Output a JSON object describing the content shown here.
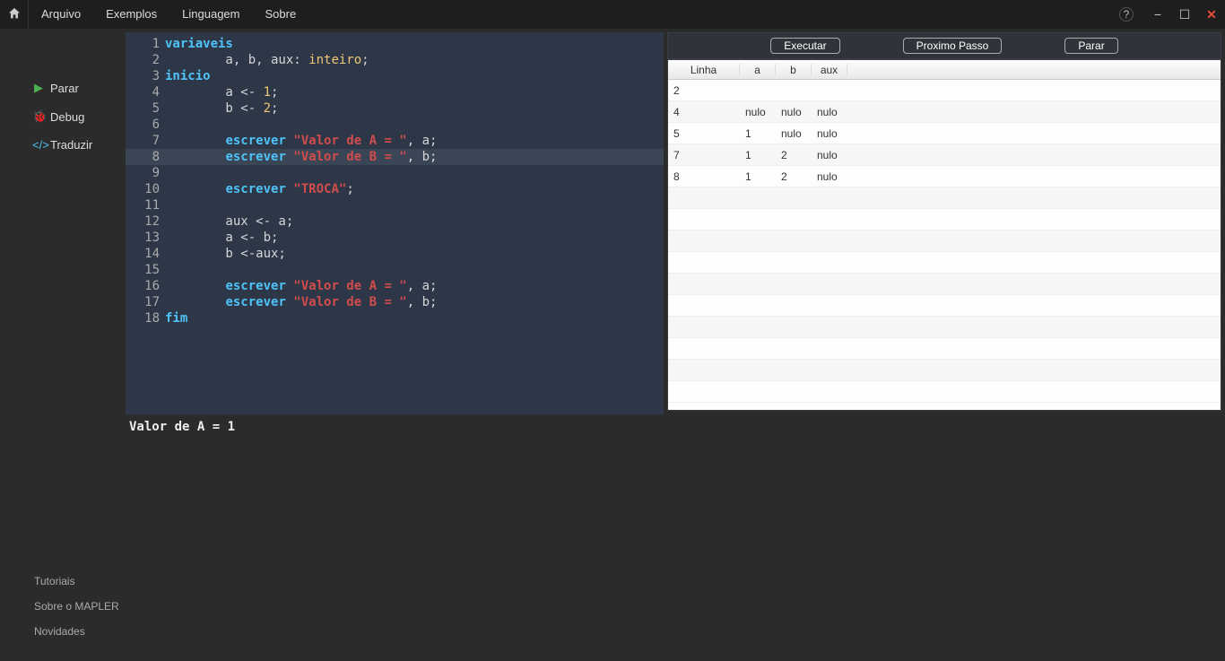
{
  "menubar": [
    "Arquivo",
    "Exemplos",
    "Linguagem",
    "Sobre"
  ],
  "sidebar": {
    "parar": "Parar",
    "debug": "Debug",
    "traduzir": "Traduzir"
  },
  "code": {
    "highlight_line": 8,
    "lines": [
      {
        "n": 1,
        "tokens": [
          {
            "t": "variaveis",
            "c": "kw-blue"
          }
        ]
      },
      {
        "n": 2,
        "tokens": [
          {
            "t": "        a, b, aux: ",
            "c": "kw-default"
          },
          {
            "t": "inteiro",
            "c": "kw-yellow"
          },
          {
            "t": ";",
            "c": "kw-default"
          }
        ]
      },
      {
        "n": 3,
        "tokens": [
          {
            "t": "inicio",
            "c": "kw-blue"
          }
        ]
      },
      {
        "n": 4,
        "tokens": [
          {
            "t": "        a <- ",
            "c": "kw-default"
          },
          {
            "t": "1",
            "c": "kw-yellow"
          },
          {
            "t": ";",
            "c": "kw-default"
          }
        ]
      },
      {
        "n": 5,
        "tokens": [
          {
            "t": "        b <- ",
            "c": "kw-default"
          },
          {
            "t": "2",
            "c": "kw-yellow"
          },
          {
            "t": ";",
            "c": "kw-default"
          }
        ]
      },
      {
        "n": 6,
        "tokens": []
      },
      {
        "n": 7,
        "tokens": [
          {
            "t": "        ",
            "c": "kw-default"
          },
          {
            "t": "escrever ",
            "c": "kw-blue"
          },
          {
            "t": "\"Valor de A = \"",
            "c": "kw-string"
          },
          {
            "t": ", a;",
            "c": "kw-default"
          }
        ]
      },
      {
        "n": 8,
        "tokens": [
          {
            "t": "        ",
            "c": "kw-default"
          },
          {
            "t": "escrever ",
            "c": "kw-blue"
          },
          {
            "t": "\"Valor de B = \"",
            "c": "kw-string"
          },
          {
            "t": ", b;",
            "c": "kw-default"
          }
        ]
      },
      {
        "n": 9,
        "tokens": []
      },
      {
        "n": 10,
        "tokens": [
          {
            "t": "        ",
            "c": "kw-default"
          },
          {
            "t": "escrever ",
            "c": "kw-blue"
          },
          {
            "t": "\"TROCA\"",
            "c": "kw-string"
          },
          {
            "t": ";",
            "c": "kw-default"
          }
        ]
      },
      {
        "n": 11,
        "tokens": []
      },
      {
        "n": 12,
        "tokens": [
          {
            "t": "        aux <- a;",
            "c": "kw-default"
          }
        ]
      },
      {
        "n": 13,
        "tokens": [
          {
            "t": "        a <- b;",
            "c": "kw-default"
          }
        ]
      },
      {
        "n": 14,
        "tokens": [
          {
            "t": "        b <-aux;",
            "c": "kw-default"
          }
        ]
      },
      {
        "n": 15,
        "tokens": []
      },
      {
        "n": 16,
        "tokens": [
          {
            "t": "        ",
            "c": "kw-default"
          },
          {
            "t": "escrever ",
            "c": "kw-blue"
          },
          {
            "t": "\"Valor de A = \"",
            "c": "kw-string"
          },
          {
            "t": ", a;",
            "c": "kw-default"
          }
        ]
      },
      {
        "n": 17,
        "tokens": [
          {
            "t": "        ",
            "c": "kw-default"
          },
          {
            "t": "escrever ",
            "c": "kw-blue"
          },
          {
            "t": "\"Valor de B = \"",
            "c": "kw-string"
          },
          {
            "t": ", b;",
            "c": "kw-default"
          }
        ]
      },
      {
        "n": 18,
        "tokens": [
          {
            "t": "fim",
            "c": "kw-blue"
          }
        ]
      }
    ]
  },
  "debug_buttons": {
    "executar": "Executar",
    "proximo": "Proximo Passo",
    "parar": "Parar"
  },
  "debug_table": {
    "headers": {
      "linha": "Linha",
      "a": "a",
      "b": "b",
      "aux": "aux"
    },
    "rows": [
      {
        "linha": "2",
        "a": "",
        "b": "",
        "aux": ""
      },
      {
        "linha": "4",
        "a": "nulo",
        "b": "nulo",
        "aux": "nulo"
      },
      {
        "linha": "5",
        "a": "1",
        "b": "nulo",
        "aux": "nulo"
      },
      {
        "linha": "7",
        "a": "1",
        "b": "2",
        "aux": "nulo"
      },
      {
        "linha": "8",
        "a": "1",
        "b": "2",
        "aux": "nulo"
      }
    ],
    "blank_rows": 10
  },
  "console_output": "Valor de A = 1",
  "bottom_links": [
    "Tutoriais",
    "Sobre o MAPLER",
    "Novidades"
  ]
}
